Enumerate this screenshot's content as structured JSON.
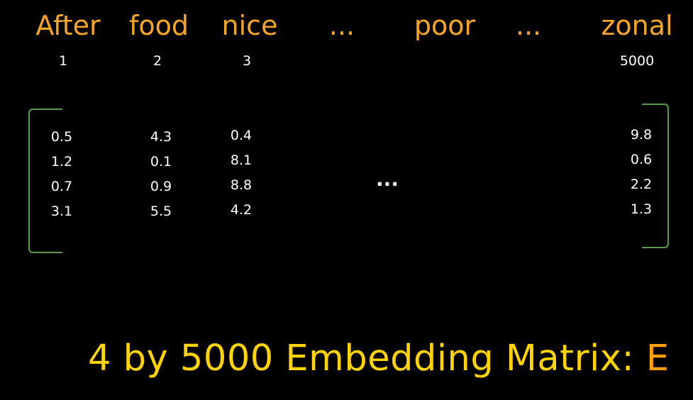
{
  "vocabulary": {
    "words": [
      "After",
      "food",
      "nice",
      "...",
      "poor",
      "...",
      "zonal"
    ],
    "indices": [
      "1",
      "2",
      "3",
      "5000"
    ]
  },
  "matrix": {
    "columns": [
      [
        "0.5",
        "1.2",
        "0.7",
        "3.1"
      ],
      [
        "4.3",
        "0.1",
        "0.9",
        "5.5"
      ],
      [
        "0.4",
        "8.1",
        "8.8",
        "4.2"
      ],
      [
        "9.8",
        "0.6",
        "2.2",
        "1.3"
      ]
    ],
    "ellipsis": "..."
  },
  "caption": {
    "text": "4 by 5000 Embedding Matrix: ",
    "symbol": "E"
  },
  "colors": {
    "word_color": "#f5a623",
    "caption_color": "#ffd400",
    "symbol_color": "#ffa000",
    "bracket_color": "#5a9a4a",
    "background": "#000000"
  }
}
